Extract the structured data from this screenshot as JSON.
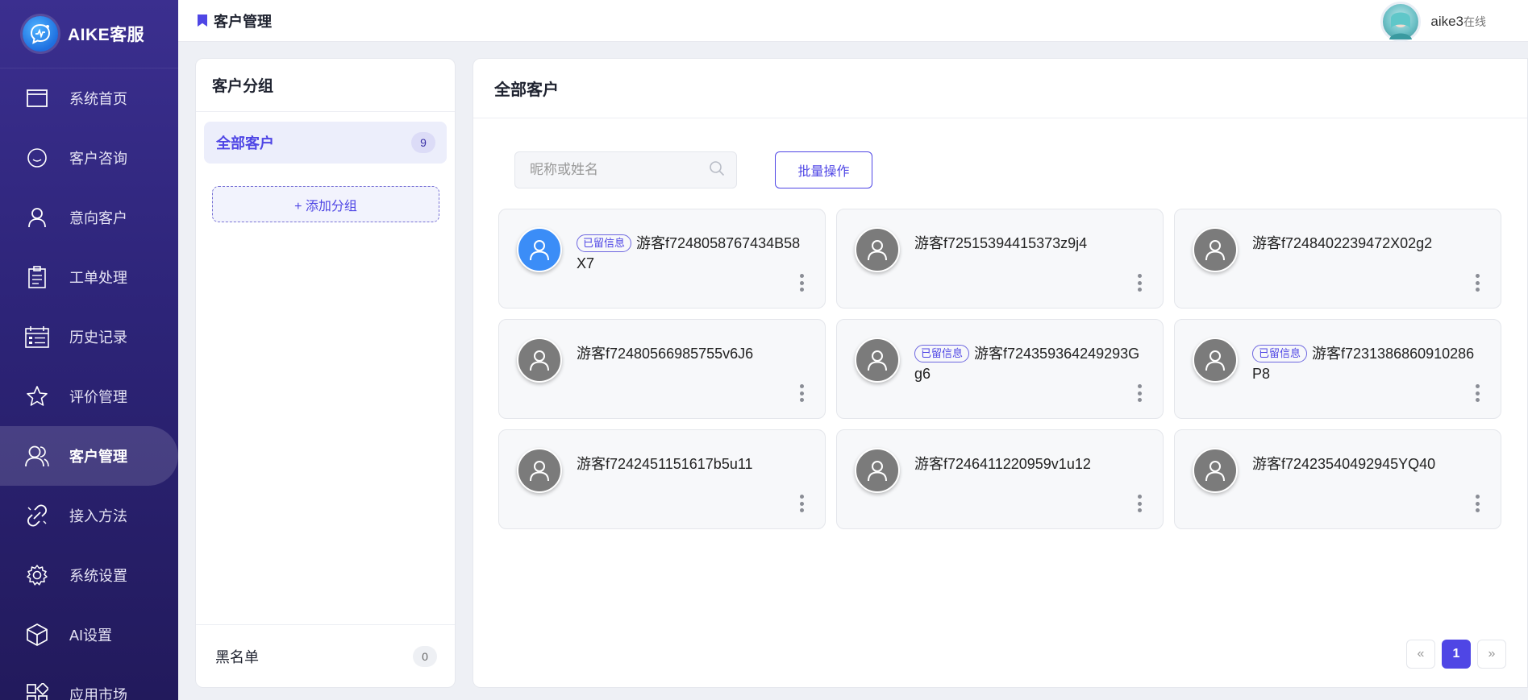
{
  "brand": {
    "name": "AIKE客服"
  },
  "nav": [
    {
      "key": "home",
      "label": "系统首页",
      "icon": "window-icon"
    },
    {
      "key": "consult",
      "label": "客户咨询",
      "icon": "chat-bubble-icon"
    },
    {
      "key": "intent",
      "label": "意向客户",
      "icon": "person-icon"
    },
    {
      "key": "ticket",
      "label": "工单处理",
      "icon": "clipboard-icon"
    },
    {
      "key": "history",
      "label": "历史记录",
      "icon": "calendar-list-icon"
    },
    {
      "key": "rating",
      "label": "评价管理",
      "icon": "star-icon"
    },
    {
      "key": "customers",
      "label": "客户管理",
      "icon": "users-icon",
      "active": true
    },
    {
      "key": "integration",
      "label": "接入方法",
      "icon": "link-icon"
    },
    {
      "key": "settings",
      "label": "系统设置",
      "icon": "gear-icon"
    },
    {
      "key": "ai",
      "label": "AI设置",
      "icon": "cube-icon"
    },
    {
      "key": "market",
      "label": "应用市场",
      "icon": "apps-icon"
    }
  ],
  "header": {
    "title": "客户管理",
    "username": "aike3",
    "status": "在线"
  },
  "groups": {
    "title": "客户分组",
    "all": {
      "label": "全部客户",
      "count": "9"
    },
    "add_label": "+ 添加分组",
    "blacklist": {
      "label": "黑名单",
      "count": "0"
    }
  },
  "main": {
    "title": "全部客户",
    "search_placeholder": "昵称或姓名",
    "batch_label": "批量操作"
  },
  "customers": [
    {
      "name": "游客f7248058767434B58X7",
      "tag": "已留信息",
      "avatar_color": "#3b8df7"
    },
    {
      "name": "游客f72515394415373z9j4",
      "tag": "",
      "avatar_color": "#7b7b7b"
    },
    {
      "name": "游客f7248402239472X02g2",
      "tag": "",
      "avatar_color": "#7b7b7b"
    },
    {
      "name": "游客f72480566985755v6J6",
      "tag": "",
      "avatar_color": "#7b7b7b"
    },
    {
      "name": "游客f724359364249293Gg6",
      "tag": "已留信息",
      "avatar_color": "#7b7b7b"
    },
    {
      "name": "游客f7231386860910286P8",
      "tag": "已留信息",
      "avatar_color": "#7b7b7b"
    },
    {
      "name": "游客f7242451151617b5u11",
      "tag": "",
      "avatar_color": "#7b7b7b"
    },
    {
      "name": "游客f7246411220959v1u12",
      "tag": "",
      "avatar_color": "#7b7b7b"
    },
    {
      "name": "游客f72423540492945YQ40",
      "tag": "",
      "avatar_color": "#7b7b7b"
    }
  ],
  "pagination": {
    "prev": "«",
    "current": "1",
    "next": "»"
  },
  "colors": {
    "accent": "#4f46e5",
    "sidebar": "#2d2478"
  }
}
